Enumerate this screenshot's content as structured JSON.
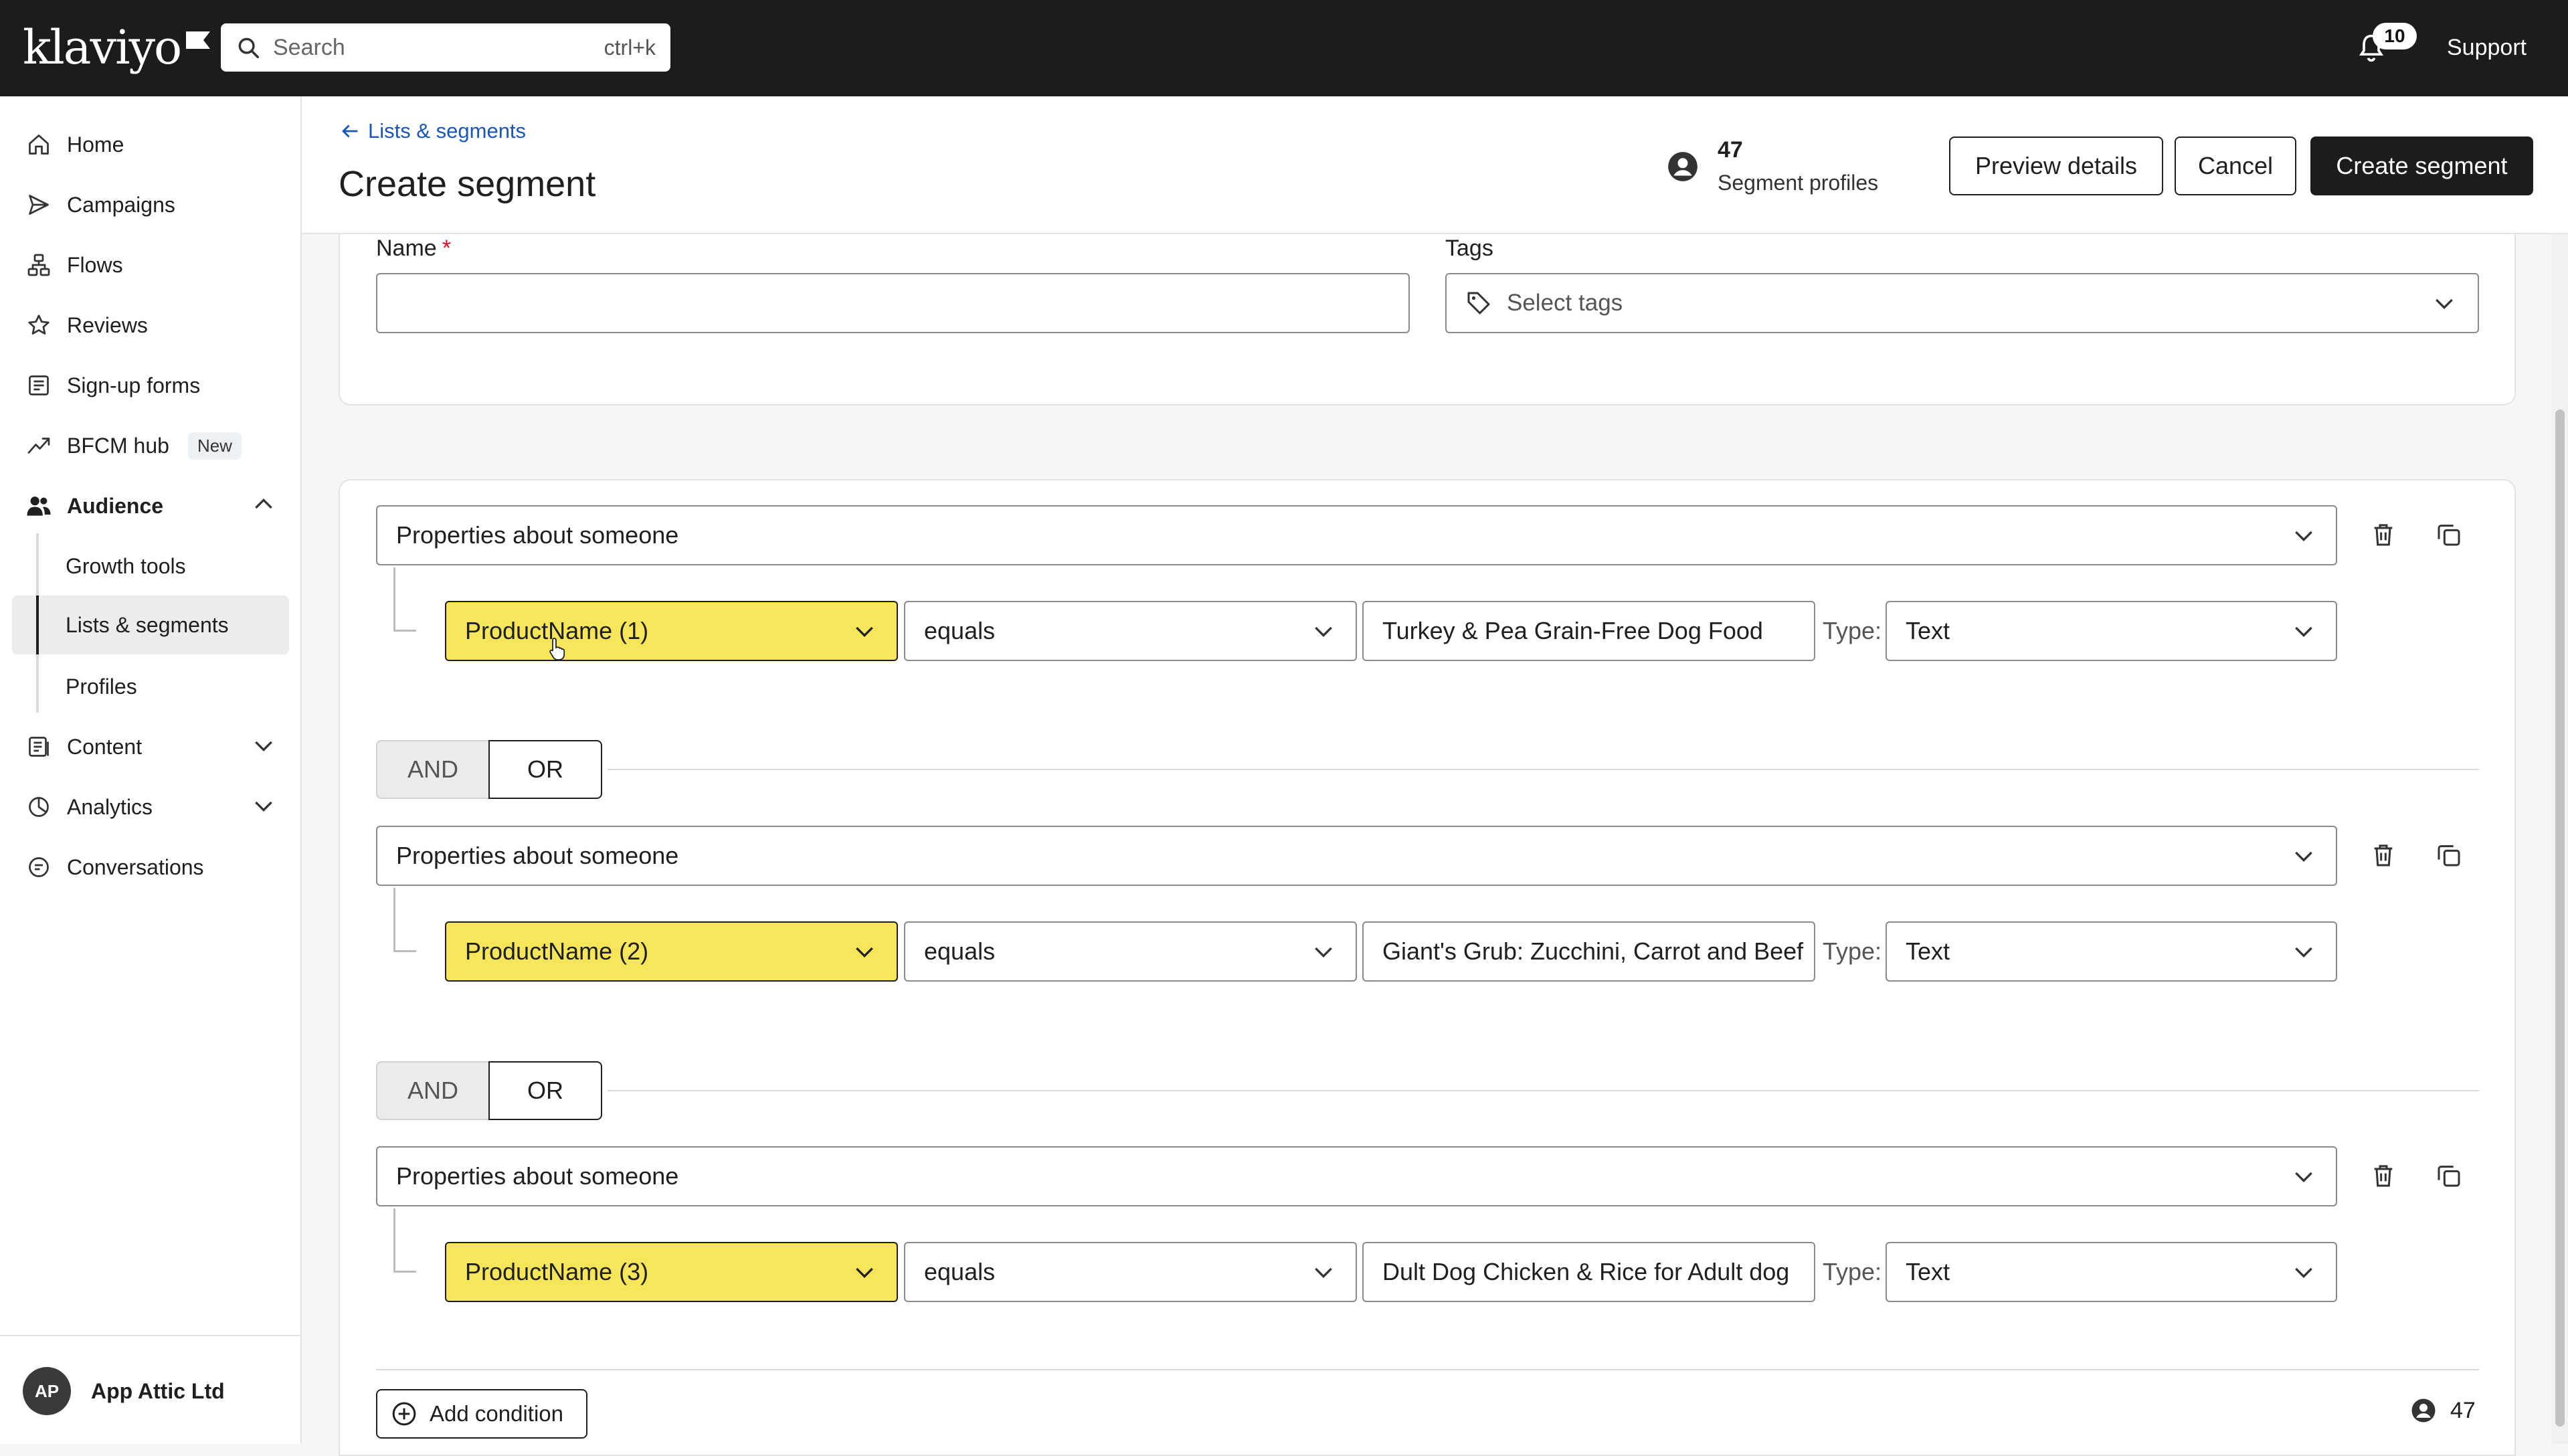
{
  "app": {
    "logo": "klaviyo"
  },
  "topbar": {
    "search_placeholder": "Search",
    "search_shortcut": "ctrl+k",
    "notification_count": "10",
    "support_label": "Support"
  },
  "sidebar": {
    "items": [
      {
        "label": "Home",
        "icon": "home-icon"
      },
      {
        "label": "Campaigns",
        "icon": "send-icon"
      },
      {
        "label": "Flows",
        "icon": "flow-icon"
      },
      {
        "label": "Reviews",
        "icon": "star-icon"
      },
      {
        "label": "Sign-up forms",
        "icon": "form-icon"
      },
      {
        "label": "BFCM hub",
        "icon": "trend-icon",
        "badge": "New"
      },
      {
        "label": "Audience",
        "icon": "people-icon",
        "expanded": true
      },
      {
        "label": "Content",
        "icon": "content-icon"
      },
      {
        "label": "Analytics",
        "icon": "analytics-icon"
      },
      {
        "label": "Conversations",
        "icon": "chat-icon"
      }
    ],
    "audience_sub": [
      {
        "label": "Growth tools"
      },
      {
        "label": "Lists & segments",
        "active": true
      },
      {
        "label": "Profiles"
      }
    ],
    "account": {
      "initials": "AP",
      "name": "App Attic Ltd"
    }
  },
  "header": {
    "back_label": "Lists & segments",
    "title": "Create segment",
    "profiles_count": "47",
    "profiles_label": "Segment profiles",
    "preview_label": "Preview details",
    "cancel_label": "Cancel",
    "create_label": "Create segment"
  },
  "form": {
    "name_label": "Name",
    "name_required": "*",
    "name_value": "",
    "tags_label": "Tags",
    "tags_placeholder": "Select tags"
  },
  "conditions": [
    {
      "group": "Properties about someone",
      "property": "ProductName (1)",
      "operator": "equals",
      "value": "Turkey & Pea Grain-Free Dog Food",
      "type_label": "Type:",
      "type": "Text"
    },
    {
      "group": "Properties about someone",
      "property": "ProductName (2)",
      "operator": "equals",
      "value": "Giant's Grub: Zucchini, Carrot and Beef",
      "type_label": "Type:",
      "type": "Text"
    },
    {
      "group": "Properties about someone",
      "property": "ProductName (3)",
      "operator": "equals",
      "value": "Dult Dog Chicken & Rice for Adult dog",
      "type_label": "Type:",
      "type": "Text"
    }
  ],
  "connectors": [
    {
      "and": "AND",
      "or": "OR"
    },
    {
      "and": "AND",
      "or": "OR"
    }
  ],
  "footer": {
    "add_condition_label": "Add condition",
    "profiles_count": "47"
  },
  "colors": {
    "topbar": "#1c1c1c",
    "highlight": "#f7e55a",
    "link": "#1a56b8",
    "required": "#d6112c"
  }
}
